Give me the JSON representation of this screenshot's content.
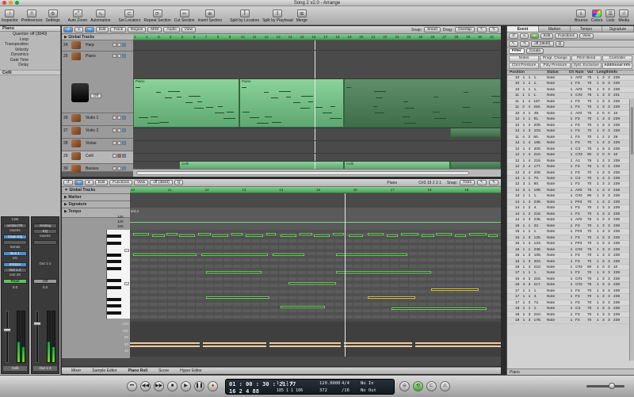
{
  "window": {
    "title": "Song 2 v2.0 - Arrange"
  },
  "toolbar": {
    "left": [
      "Inspector",
      "Preferences",
      "Settings",
      "Auto Zoom",
      "Automation",
      "Set Locators",
      "Repeat Section",
      "Cut Section",
      "Insert Section",
      "Split by Locators",
      "Split by Playhead",
      "Merge"
    ],
    "right": [
      "Bounce",
      "Colors",
      "Lists",
      "Media"
    ]
  },
  "inspector": {
    "header": "Piano",
    "rows": [
      {
        "k": "Quantize",
        "v": "off (3840)"
      },
      {
        "k": "Loop",
        "v": ""
      },
      {
        "k": "Transposition",
        "v": ""
      },
      {
        "k": "Velocity",
        "v": ""
      },
      {
        "k": "Dynamics",
        "v": ""
      },
      {
        "k": "Gate Time",
        "v": ""
      },
      {
        "k": "Delay",
        "v": ""
      }
    ],
    "fold": "Celli",
    "strip1": {
      "name": "Celli",
      "setting": "wrdbmTR",
      "inserts": "Inserts",
      "eq": "Chan EQ",
      "sends": "Sends",
      "bus": "Bus 1",
      "io": "I/O",
      "input": "EXS24",
      "output": "Out 1-2",
      "group": "Inst 29",
      "mode": "Read",
      "db": "0.0"
    },
    "strip2": {
      "name": "Out 1-2",
      "setting": "Setting",
      "eq": "EQ",
      "inserts": "Inserts",
      "out": "Out 1-2",
      "mode": "Off",
      "db": "0.0",
      "foot": "Bnce"
    }
  },
  "arrange": {
    "menus": [
      "Edit",
      "Track",
      "Region",
      "MIDI",
      "Audio",
      "View"
    ],
    "snap_label": "Snap:",
    "snap": "Smart",
    "drag_label": "Drag:",
    "drag": "Overlap",
    "global_tracks": "Global Tracks",
    "ruler": [
      "1",
      "2",
      "3",
      "4",
      "5",
      "6",
      "7",
      "8",
      "9",
      "10",
      "11",
      "12",
      "13",
      "14",
      "15",
      "16",
      "17",
      "18",
      "19",
      "20",
      "21",
      "22",
      "23",
      "24",
      "25",
      "26",
      "27",
      "28",
      "29",
      "30",
      "31"
    ],
    "tracks": [
      {
        "num": "24",
        "name": "Harp",
        "sel": false
      },
      {
        "num": "25",
        "name": "Piano",
        "sel": false
      },
      {
        "num": "26",
        "name": "Violin 1",
        "sel": false
      },
      {
        "num": "27",
        "name": "Violin 2",
        "sel": false
      },
      {
        "num": "28",
        "name": "Violas",
        "sel": false
      },
      {
        "num": "29",
        "name": "Celli",
        "sel": true
      },
      {
        "num": "30",
        "name": "Basses",
        "sel": false
      }
    ],
    "piano_off": "Off",
    "region_labels": {
      "piano": "Piano",
      "piano2": "Piano",
      "celli1": "Celli",
      "celli2": "Celli"
    }
  },
  "pianoroll": {
    "menus": [
      "Edit",
      "Functions",
      "View"
    ],
    "quantize": "off (3840)",
    "region_name": "Piano",
    "position": "C#3  19 2 3 1",
    "snap_label": "Snap:",
    "snap": "Ticks",
    "global_tracks": "Global Tracks",
    "rows": [
      "Marker",
      "Signature",
      "Tempo"
    ],
    "signature_value": "4/4  A",
    "tempo_values": [
      "140",
      "120",
      "100"
    ],
    "ruler": [
      "10",
      "11",
      "12",
      "13",
      "14",
      "15",
      "16",
      "17",
      "18",
      "19"
    ],
    "keys": [
      "C3",
      "C2"
    ],
    "vel_axis": [
      "120",
      "100",
      "80",
      "60",
      "40"
    ]
  },
  "bottom_tabs": [
    "Mixer",
    "Sample Editor",
    "Piano Roll",
    "Score",
    "Hyper Editor"
  ],
  "events": {
    "tabs": [
      "Event",
      "Marker",
      "Tempo",
      "Signature"
    ],
    "menus": [
      "Edit",
      "Functions",
      "View"
    ],
    "quantize": "off (3840)",
    "filter": "Filter",
    "create": "Create",
    "types": [
      "Notes",
      "Progr. Change",
      "Pitch Bend",
      "Controller",
      "Chnl Pressure",
      "Poly Pressure",
      "Syst. Exclusive",
      "Additional Info"
    ],
    "cols": [
      "Position",
      "Status",
      "Ch",
      "Num",
      "Val",
      "Length/Info"
    ],
    "rows": [
      [
        "10 1 1 1.",
        "Note",
        "1",
        "A#2",
        "75",
        "1 3 3 239"
      ],
      [
        "10 1 1 1.",
        "Note",
        "1",
        "F3",
        "70",
        "1 3 3 239"
      ],
      [
        "10 1 1 1.",
        "Note",
        "1",
        "A#3",
        "75",
        "1 3 3 239"
      ],
      [
        "11 1 1 1.",
        "Note",
        "1",
        "C#2",
        "75",
        "1 3 3 231"
      ],
      [
        "11 1 4 187.",
        "Note",
        "1",
        "F3",
        "70",
        "1 3 3 239"
      ],
      [
        "11 2 4 240.",
        "Note",
        "1",
        "F3",
        "70",
        "1 3 3 239"
      ],
      [
        "10 4 1 49.",
        "Note",
        "1",
        "A#2",
        "75",
        "2 0 0 10"
      ],
      [
        "12 1 1 91.",
        "Note",
        "1",
        "F3",
        "70",
        "1 3 3 239"
      ],
      [
        "12 1 2 209.",
        "Note",
        "1",
        "F3",
        "70",
        "1 3 3 239"
      ],
      [
        "12 1 3 103.",
        "Note",
        "1",
        "F3",
        "70",
        "1 3 3 239"
      ],
      [
        "11 4 3 60.",
        "Note",
        "1",
        "F3",
        "70",
        "1 2 2 29"
      ],
      [
        "12 1 4 195.",
        "Note",
        "1",
        "F3",
        "70",
        "1 3 3 239"
      ],
      [
        "12 1 4 200.",
        "Note",
        "1",
        "C3",
        "70",
        "1 3 3 239"
      ],
      [
        "12 1 4 210.",
        "Note",
        "1",
        "C#3",
        "90",
        "2 0 0 10"
      ],
      [
        "12 1 4 216.",
        "Note",
        "1",
        "A1",
        "75",
        "1 3 3 239"
      ],
      [
        "12 2 4 177.",
        "Note",
        "1",
        "F3",
        "70",
        "1 3 3 239"
      ],
      [
        "12 2 4 208.",
        "Note",
        "1",
        "F3",
        "70",
        "1 3 3 239"
      ],
      [
        "13 1 1 70.",
        "Note",
        "1",
        "C3",
        "70",
        "1 3 3 239"
      ],
      [
        "12 3 1 80.",
        "Note",
        "1",
        "F3",
        "70",
        "1 3 3 239"
      ],
      [
        "12 3 1 199.",
        "Note",
        "1",
        "A#2",
        "75",
        "1 3 3 239"
      ],
      [
        "13 1 1 1.",
        "Note",
        "1",
        "C#2",
        "90",
        "1 3 3 239"
      ],
      [
        "14 1 4 239.",
        "Note",
        "1",
        "F#3",
        "70",
        "1 3 3 239"
      ],
      [
        "14 1 2 4.",
        "Note",
        "1",
        "F3",
        "70",
        "1 3 3 239"
      ],
      [
        "14 1 2 218.",
        "Note",
        "1",
        "F3",
        "70",
        "1 3 3 239"
      ],
      [
        "14 1 3 235.",
        "Note",
        "1",
        "A#2",
        "75",
        "1 3 3 239"
      ],
      [
        "15 1 1 32.",
        "Note",
        "1",
        "F3",
        "70",
        "1 3 3 239"
      ],
      [
        "15 1 1 1.",
        "Note",
        "1",
        "F#3",
        "70",
        "1 3 3 239"
      ],
      [
        "15 1 3 125.",
        "Note",
        "1",
        "F3",
        "70",
        "1 3 3 239"
      ],
      [
        "15 1 4 123.",
        "Note",
        "1",
        "F#3",
        "70",
        "1 3 3 239"
      ],
      [
        "16 1 1 239.",
        "Note",
        "1",
        "C#2",
        "75",
        "1 3 3 239"
      ],
      [
        "16 1 3 108.",
        "Note",
        "1",
        "F3",
        "70",
        "1 3 3 239"
      ],
      [
        "16 1 3 203.",
        "Note",
        "1",
        "F3",
        "70",
        "1 3 3 239"
      ],
      [
        "16 1 4 210.",
        "Note",
        "1",
        "C#3",
        "90",
        "2 0 0 10"
      ],
      [
        "17 1 1 1.",
        "Note",
        "1",
        "F3",
        "70",
        "1 3 3 239"
      ],
      [
        "16 4 3 215.",
        "Note",
        "1",
        "C#1",
        "70",
        "1 3 3 239"
      ],
      [
        "16 4 3 217.",
        "Note",
        "1",
        "C#2",
        "75",
        "1 3 3 239"
      ],
      [
        "17 1 1 1.",
        "Note",
        "1",
        "F3",
        "70",
        "1 3 3 239"
      ],
      [
        "17 1 1 4.",
        "Note",
        "1",
        "F3",
        "70",
        "1 3 3 239"
      ],
      [
        "17 1 3 72.",
        "Note",
        "1",
        "F3",
        "70",
        "1 3 3 239"
      ],
      [
        "18 1 1 1.",
        "Note",
        "1",
        "C3",
        "70",
        "1 3 3 239"
      ],
      [
        "18 1 3 210.",
        "Note",
        "1",
        "F3",
        "70",
        "1 3 3 239"
      ],
      [
        "18 1 3 178.",
        "Note",
        "1",
        "F3",
        "70",
        "1 3 3 239"
      ]
    ],
    "footer": "Piano"
  },
  "transport": {
    "smpte": "01 : 00 : 30 : 21.77",
    "bars": "16  2  4  88",
    "smpte2": "1   1   1   1",
    "bars2": "185   1   1   106",
    "tempo": "120.0000",
    "tempo2": "372",
    "sig": "4/4",
    "sig2": "/16",
    "in": "No In",
    "out": "No Out"
  }
}
